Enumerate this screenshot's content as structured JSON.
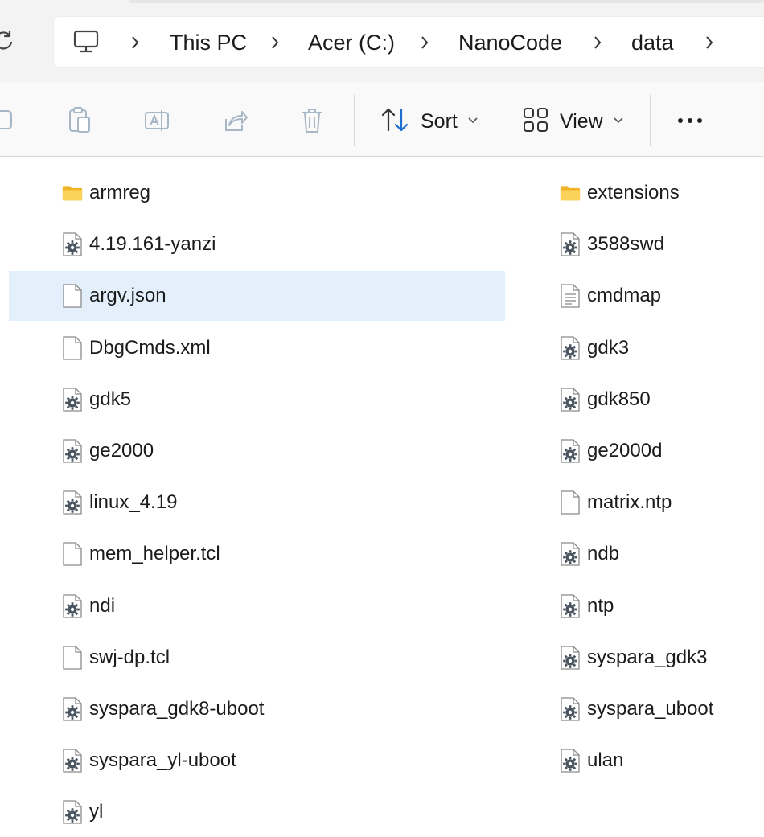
{
  "address_bar": {
    "breadcrumbs": [
      {
        "label": "This PC"
      },
      {
        "label": "Acer (C:)"
      },
      {
        "label": "NanoCode"
      },
      {
        "label": "data"
      }
    ],
    "leading_icon": "computer-icon",
    "refresh_icon": "refresh-icon"
  },
  "toolbar": {
    "icons": [
      "copy-icon",
      "paste-icon",
      "rename-icon",
      "share-icon",
      "delete-icon"
    ],
    "sort_label": "Sort",
    "view_label": "View",
    "more_label": "•••"
  },
  "files": {
    "column_left": [
      {
        "name": "armreg",
        "type": "folder"
      },
      {
        "name": "4.19.161-yanzi",
        "type": "system-file"
      },
      {
        "name": "argv.json",
        "type": "file",
        "selected": true
      },
      {
        "name": "DbgCmds.xml",
        "type": "file"
      },
      {
        "name": "gdk5",
        "type": "system-file"
      },
      {
        "name": "ge2000",
        "type": "system-file"
      },
      {
        "name": "linux_4.19",
        "type": "system-file"
      },
      {
        "name": "mem_helper.tcl",
        "type": "file"
      },
      {
        "name": "ndi",
        "type": "system-file"
      },
      {
        "name": "swj-dp.tcl",
        "type": "file"
      },
      {
        "name": "syspara_gdk8-uboot",
        "type": "system-file"
      },
      {
        "name": "syspara_yl-uboot",
        "type": "system-file"
      },
      {
        "name": "yl",
        "type": "system-file"
      }
    ],
    "column_right": [
      {
        "name": "extensions",
        "type": "folder"
      },
      {
        "name": "3588swd",
        "type": "system-file"
      },
      {
        "name": "cmdmap",
        "type": "text-file"
      },
      {
        "name": "gdk3",
        "type": "system-file"
      },
      {
        "name": "gdk850",
        "type": "system-file"
      },
      {
        "name": "ge2000d",
        "type": "system-file"
      },
      {
        "name": "matrix.ntp",
        "type": "file"
      },
      {
        "name": "ndb",
        "type": "system-file"
      },
      {
        "name": "ntp",
        "type": "system-file"
      },
      {
        "name": "syspara_gdk3",
        "type": "system-file"
      },
      {
        "name": "syspara_uboot",
        "type": "system-file"
      },
      {
        "name": "ulan",
        "type": "system-file"
      }
    ]
  },
  "colors": {
    "selection_bg": "#e3f0fb",
    "folder_yellow": "#f8c440",
    "accent_blue": "#1f6fd1"
  }
}
